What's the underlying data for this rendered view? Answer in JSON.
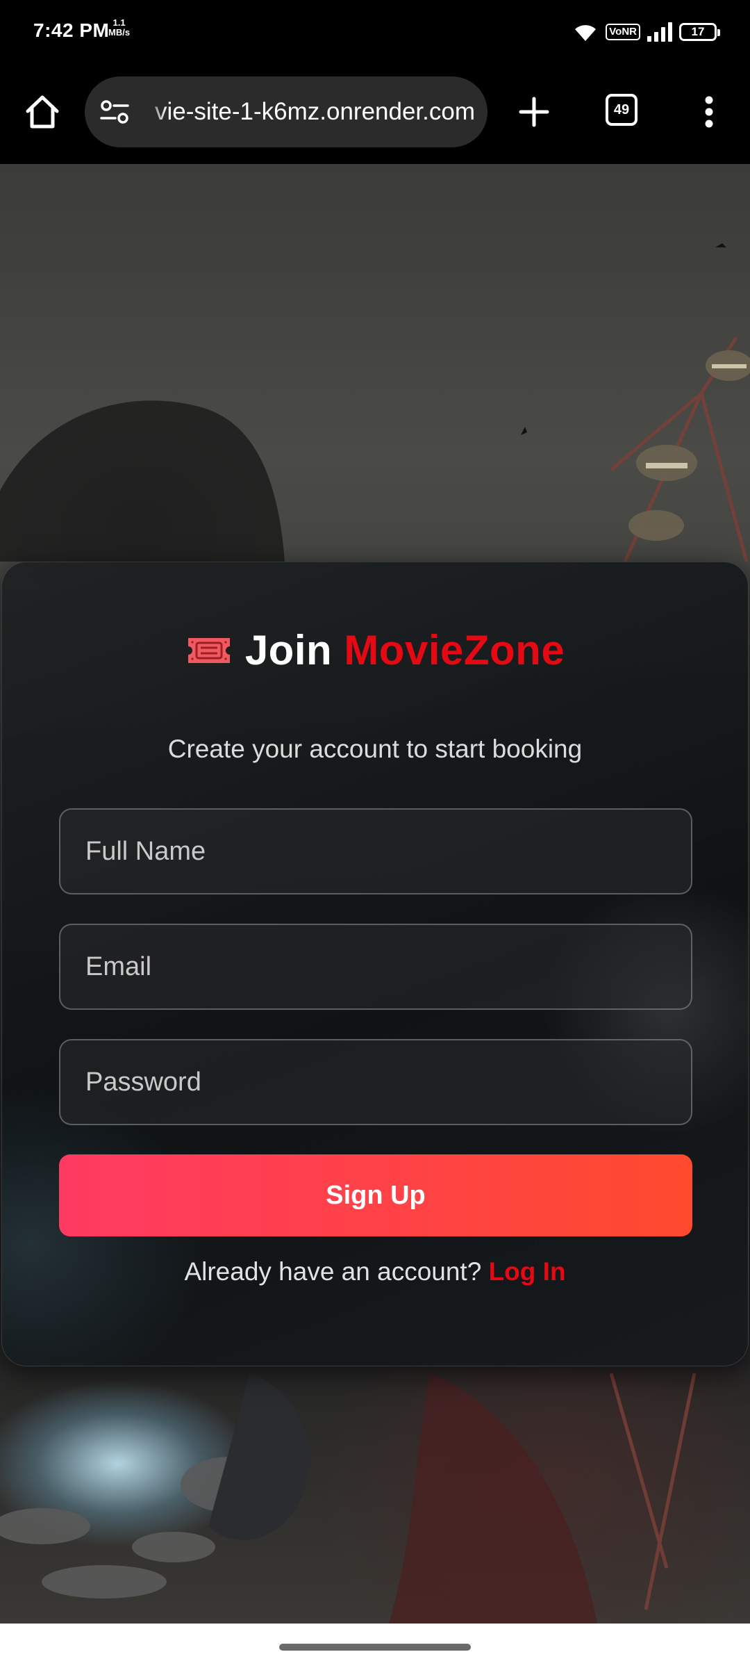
{
  "status_bar": {
    "time": "7:42 PM",
    "net_speed_value": "1.1",
    "net_speed_unit": "MB/s",
    "vonr_label": "VoNR",
    "battery_level": "17"
  },
  "browser": {
    "url": "vie-site-1-k6mz.onrender.com",
    "tab_count": "49"
  },
  "signup": {
    "title_prefix": "Join",
    "brand_name": "MovieZone",
    "subtitle": "Create your account to start booking",
    "fullname_placeholder": "Full Name",
    "email_placeholder": "Email",
    "password_placeholder": "Password",
    "submit_label": "Sign Up",
    "login_prompt": "Already have an account?",
    "login_link": "Log In"
  },
  "colors": {
    "brand_red": "#e50914",
    "button_gradient_start": "#ff3a62",
    "button_gradient_end": "#ff4a2e"
  },
  "icons": [
    "home-icon",
    "site-settings-icon",
    "plus-icon",
    "tab-switcher-icon",
    "more-vert-icon",
    "ticket-icon",
    "wifi-icon",
    "signal-icon",
    "battery-icon"
  ]
}
